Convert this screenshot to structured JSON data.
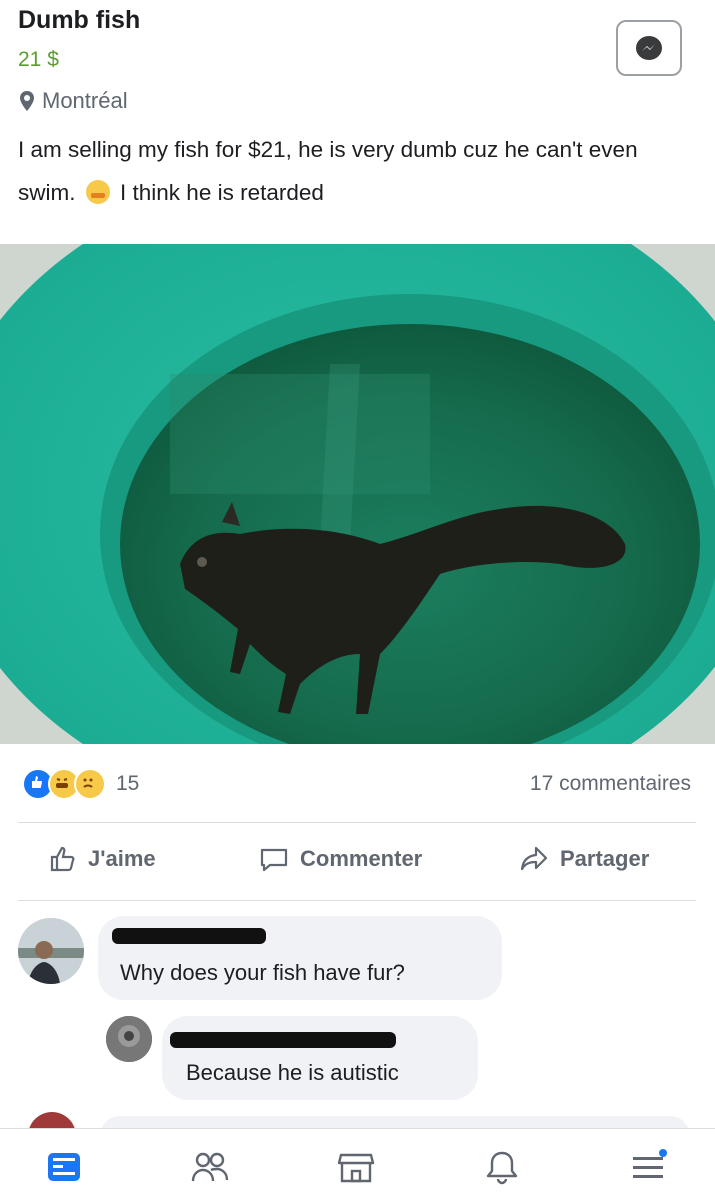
{
  "listing": {
    "title": "Dumb fish",
    "price": "21 $",
    "location": "Montréal",
    "description_part1": "I am selling my fish for $21, he is very dumb cuz he can't even swim.",
    "description_part2": "I think he is retarded"
  },
  "reactions": {
    "count": "15",
    "comments": "17 commentaires"
  },
  "actions": {
    "like": "J'aime",
    "comment": "Commenter",
    "share": "Partager"
  },
  "comments": [
    {
      "text": "Why does your fish have fur?"
    },
    {
      "text": "Because he is autistic"
    }
  ],
  "colors": {
    "accent": "#1877f2",
    "price": "#5a9e2f",
    "water": "#1e9c86"
  }
}
